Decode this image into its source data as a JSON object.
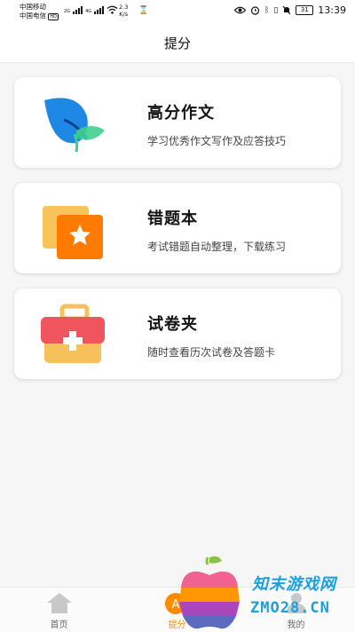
{
  "status_bar": {
    "carrier1": "中国移动",
    "carrier2": "中国电信",
    "hd_badge": "HD",
    "net1": "2G",
    "net2": "4G",
    "speed_value": "2.3",
    "speed_unit": "K/s",
    "battery": "31",
    "time": "13:39"
  },
  "header": {
    "title": "提分"
  },
  "cards": [
    {
      "title": "高分作文",
      "subtitle": "学习优秀作文写作及应答技巧",
      "icon": "leaf-icon"
    },
    {
      "title": "错题本",
      "subtitle": "考试错题自动整理，下载练习",
      "icon": "star-folder-icon"
    },
    {
      "title": "试卷夹",
      "subtitle": "随时查看历次试卷及答题卡",
      "icon": "toolbox-icon"
    }
  ],
  "tabs": [
    {
      "label": "首页",
      "icon": "home-icon"
    },
    {
      "label": "提分",
      "icon": "score-icon",
      "active": true
    },
    {
      "label": "我的",
      "icon": "profile-icon"
    }
  ],
  "watermark": {
    "text1": "知末游戏网",
    "text2": "ZMO28.CN"
  },
  "colors": {
    "accent": "#ff8a00",
    "leaf_blue": "#1e88e5",
    "leaf_green": "#3ecf8e",
    "folder_orange": "#ff7a00",
    "toolbox_red": "#f0545c",
    "toolbox_yellow": "#f6c05a",
    "watermark_blue": "#1aa0e0"
  }
}
